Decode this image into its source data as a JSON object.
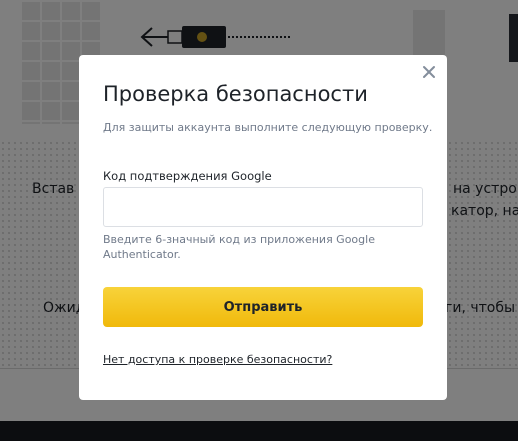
{
  "background": {
    "line_left_1": "Встав",
    "line_right_1": "на устрой",
    "line_right_2": "катор, наж",
    "line_left_3": "Ожид",
    "line_right_3": "ги, чтобы пр"
  },
  "modal": {
    "title": "Проверка безопасности",
    "subtitle": "Для защиты аккаунта выполните следующую проверку.",
    "field_label": "Код подтверждения Google",
    "input_value": "",
    "hint": "Введите 6-значный код из приложения Google Authenticator.",
    "submit_label": "Отправить",
    "no_access_link": "Нет доступа к проверке безопасности?",
    "close_icon": "close-icon"
  },
  "colors": {
    "accent": "#f0b90b",
    "overlay": "rgba(0,0,0,0.5)",
    "text_primary": "#1e2329",
    "text_secondary": "#707a8a"
  }
}
